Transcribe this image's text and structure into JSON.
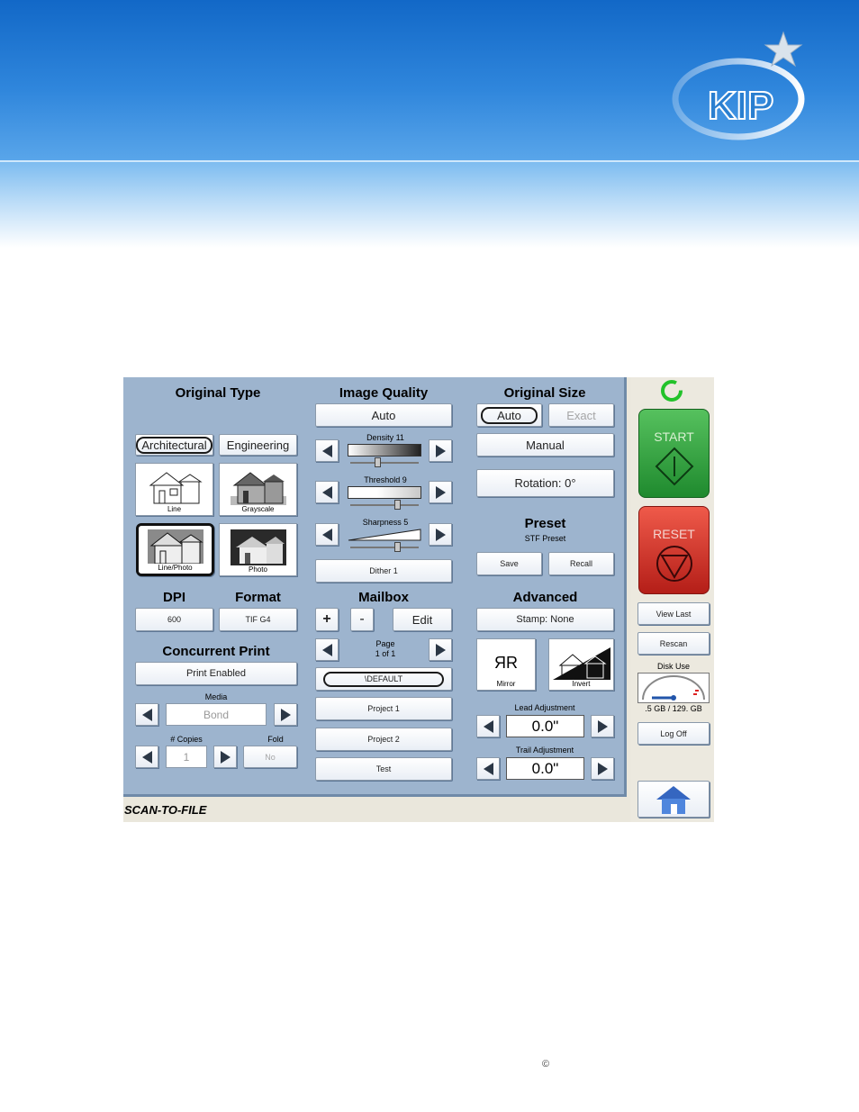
{
  "brand": {
    "logo_text": "KIP"
  },
  "original_type": {
    "title": "Original Type",
    "architectural": "Architectural",
    "engineering": "Engineering",
    "thumbs": {
      "line": "Line",
      "grayscale": "Grayscale",
      "line_photo": "Line/Photo",
      "photo": "Photo"
    }
  },
  "image_quality": {
    "title": "Image Quality",
    "auto": "Auto",
    "density": "Density 11",
    "threshold": "Threshold 9",
    "sharpness": "Sharpness 5",
    "dither": "Dither 1"
  },
  "original_size": {
    "title": "Original Size",
    "auto": "Auto",
    "exact": "Exact",
    "manual": "Manual",
    "rotation": "Rotation: 0°"
  },
  "preset": {
    "title": "Preset",
    "name": "STF Preset",
    "save": "Save",
    "recall": "Recall"
  },
  "dpi": {
    "title": "DPI",
    "value": "600"
  },
  "format": {
    "title": "Format",
    "value": "TIF G4"
  },
  "concurrent": {
    "title": "Concurrent Print",
    "print_enabled": "Print Enabled",
    "media_label": "Media",
    "media_value": "Bond",
    "copies_label": "# Copies",
    "copies_value": "1",
    "fold_label": "Fold",
    "fold_value": "No"
  },
  "mailbox": {
    "title": "Mailbox",
    "plus": "+",
    "minus": "-",
    "edit": "Edit",
    "page_label": "Page",
    "page_value": "1 of 1",
    "items": [
      "\\DEFAULT",
      "Project 1",
      "Project 2",
      "Test"
    ]
  },
  "advanced": {
    "title": "Advanced",
    "stamp": "Stamp: None",
    "mirror": "Mirror",
    "mirror_glyph": "ЯR",
    "invert": "Invert",
    "lead_label": "Lead Adjustment",
    "lead_value": "0.0\"",
    "trail_label": "Trail Adjustment",
    "trail_value": "0.0\""
  },
  "side": {
    "start": "START",
    "reset": "RESET",
    "view_last": "View Last",
    "rescan": "Rescan",
    "disk_use_label": "Disk Use",
    "disk_use_value": ".5 GB / 129. GB",
    "log_off": "Log Off"
  },
  "footer": {
    "mode": "SCAN-TO-FILE"
  },
  "page": {
    "copyright": "©"
  },
  "colors": {
    "panel": "#9db4ce",
    "start": "#2e9e3a",
    "reset": "#d0382c",
    "banner": "#1a6fcc"
  }
}
